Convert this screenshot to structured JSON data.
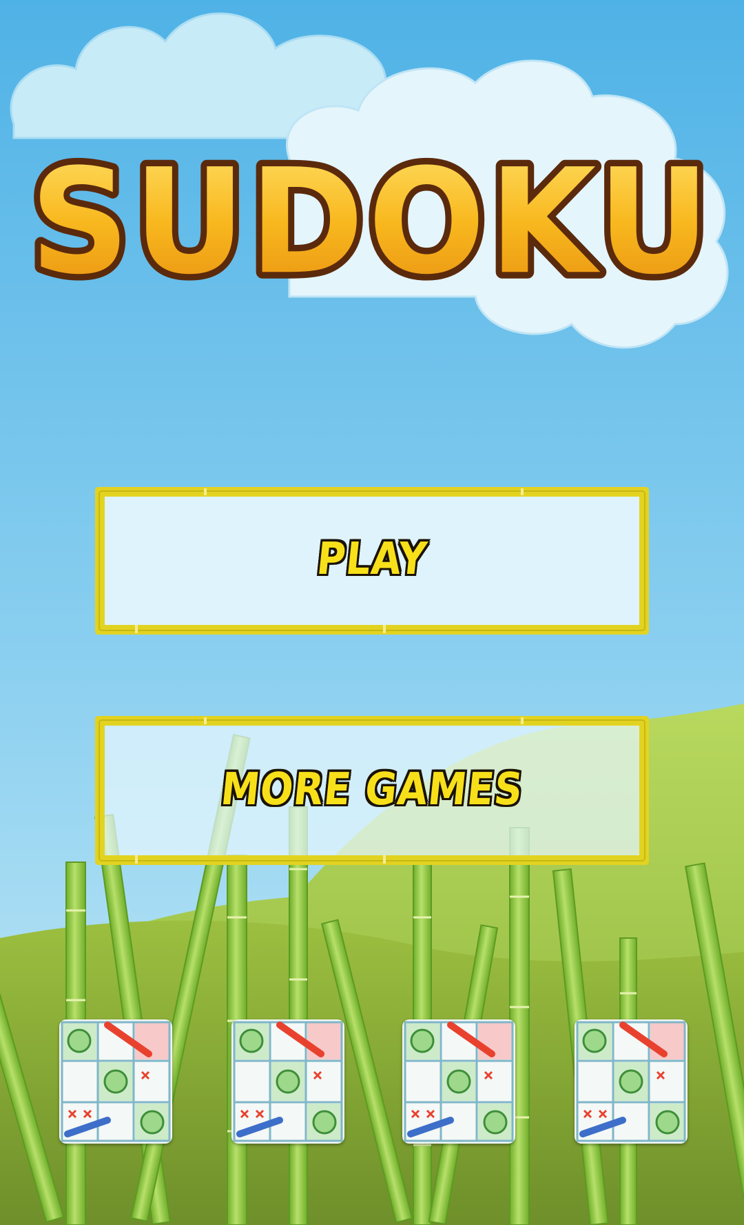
{
  "app": {
    "title": "SUDOKU"
  },
  "menu": {
    "play_label": "PLAY",
    "more_games_label": "MORE GAMES"
  },
  "colors": {
    "sky_top": "#5CB8E8",
    "sky_bottom": "#BFE6F7",
    "title_fill": "#F6A916",
    "title_outline": "#5B2A0C",
    "button_frame": "#E8DA20",
    "button_panel": "#E6F6FD",
    "label_yellow": "#F7E01A",
    "hill_green": "#9CC24A",
    "bamboo_green": "#8CC63F"
  },
  "game_tiles": [
    {
      "icon": "sudoku-board-icon"
    },
    {
      "icon": "sudoku-board-icon"
    },
    {
      "icon": "sudoku-board-icon"
    },
    {
      "icon": "sudoku-board-icon"
    }
  ]
}
